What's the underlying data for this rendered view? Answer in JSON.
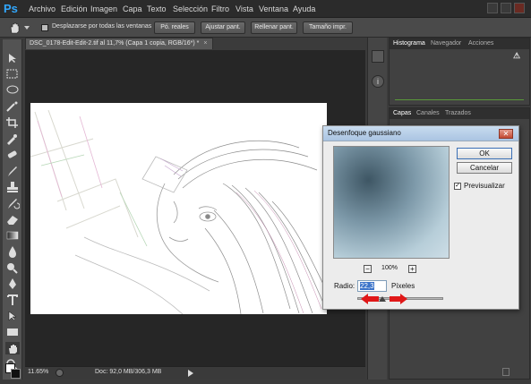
{
  "app": {
    "logo": "Ps"
  },
  "menu": [
    "Archivo",
    "Edición",
    "Imagen",
    "Capa",
    "Texto",
    "Selección",
    "Filtro",
    "Vista",
    "Ventana",
    "Ayuda"
  ],
  "options": {
    "scroll_all_label": "Desplazarse por todas las ventanas",
    "actual_pixels": "Pó. reales",
    "fit_screen": "Ajustar pant.",
    "fill_screen": "Rellenar pant.",
    "print_size": "Tamaño impr."
  },
  "document": {
    "tab_title": "DSC_0178-Edit-Edit-2.tif al 11,7% (Capa 1 copia, RGB/16*) *",
    "zoom": "11.65%",
    "doc_size": "Doc: 92,0 MB/306,3 MB"
  },
  "panels": {
    "top_tabs": [
      "Histograma",
      "Navegador",
      "Acciones"
    ],
    "layer_tabs": [
      "Capas",
      "Canales",
      "Trazados"
    ]
  },
  "dialog": {
    "title": "Desenfoque gaussiano",
    "ok": "OK",
    "cancel": "Cancelar",
    "preview_label": "Previsualizar",
    "preview_checked": true,
    "zoom": "100%",
    "radius_label": "Radio:",
    "radius_value": "22,3",
    "radius_unit": "Píxeles"
  },
  "colors": {
    "accent_blue": "#31a8ff",
    "arrow_red": "#e01818"
  }
}
